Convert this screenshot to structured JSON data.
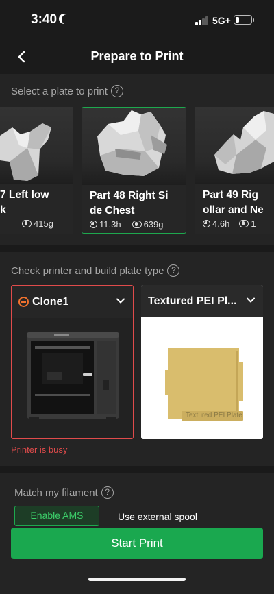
{
  "status_bar": {
    "time": "3:40",
    "network": "5G+"
  },
  "header": {
    "title": "Prepare to Print"
  },
  "plates_section": {
    "label": "Select a plate to print",
    "plates": [
      {
        "name": "7 Left low\nk",
        "time": "",
        "weight": "415g",
        "selected": false
      },
      {
        "name": "Part 48 Right Si\nde Chest",
        "time": "11.3h",
        "weight": "639g",
        "selected": true
      },
      {
        "name": "Part 49 Rig\nollar and Ne",
        "time": "4.6h",
        "weight": "1",
        "selected": false
      }
    ]
  },
  "printer_section": {
    "label": "Check printer and build plate type",
    "printer": {
      "name": "Clone1",
      "status": "Printer is busy"
    },
    "plate_type": {
      "name": "Textured PEI Pl...",
      "plate_caption": "Textured PEI Plate"
    }
  },
  "filament_section": {
    "label": "Match my filament",
    "enable_ams": "Enable AMS",
    "external_spool": "Use external spool"
  },
  "start_button": "Start Print",
  "colors": {
    "accent_green": "#1aa84f",
    "error_red": "#e04b4b",
    "busy_orange": "#f0722e"
  }
}
